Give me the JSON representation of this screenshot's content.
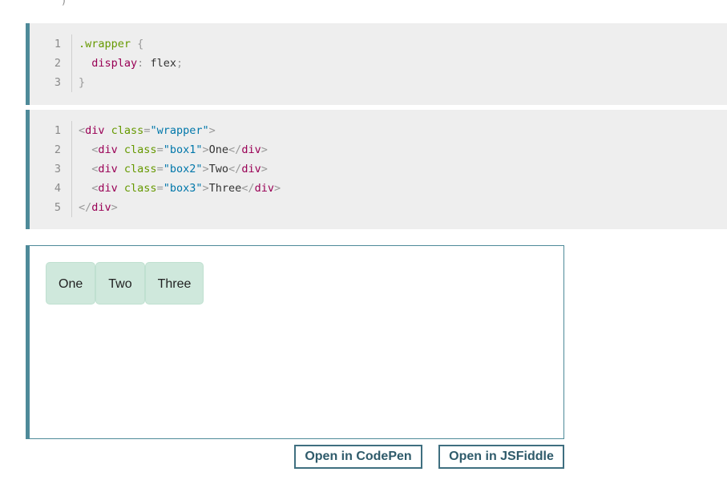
{
  "top_fragment": ")",
  "css_block": {
    "line_numbers": [
      "1",
      "2",
      "3"
    ],
    "line1": {
      "selector": ".wrapper",
      "brace": " {"
    },
    "line2": {
      "indent": "  ",
      "property": "display",
      "colon": ": ",
      "value": "flex",
      "semi": ";"
    },
    "line3": {
      "brace": "}"
    }
  },
  "html_block": {
    "line_numbers": [
      "1",
      "2",
      "3",
      "4",
      "5"
    ],
    "line1": {
      "open": "<",
      "tag": "div",
      "attr": " class",
      "eq": "=",
      "q1": "\"",
      "str": "wrapper",
      "q2": "\"",
      "close": ">"
    },
    "line2": {
      "indent": "  ",
      "open": "<",
      "tag": "div",
      "attr": " class",
      "eq": "=",
      "q1": "\"",
      "str": "box1",
      "q2": "\"",
      "close": ">",
      "text": "One",
      "end_open": "</",
      "end_tag": "div",
      "end_close": ">"
    },
    "line3": {
      "indent": "  ",
      "open": "<",
      "tag": "div",
      "attr": " class",
      "eq": "=",
      "q1": "\"",
      "str": "box2",
      "q2": "\"",
      "close": ">",
      "text": "Two",
      "end_open": "</",
      "end_tag": "div",
      "end_close": ">"
    },
    "line4": {
      "indent": "  ",
      "open": "<",
      "tag": "div",
      "attr": " class",
      "eq": "=",
      "q1": "\"",
      "str": "box3",
      "q2": "\"",
      "close": ">",
      "text": "Three",
      "end_open": "</",
      "end_tag": "div",
      "end_close": ">"
    },
    "line5": {
      "end_open": "</",
      "end_tag": "div",
      "end_close": ">"
    }
  },
  "result": {
    "boxes": [
      "One",
      "Two",
      "Three"
    ]
  },
  "buttons": {
    "codepen": "Open in CodePen",
    "jsfiddle": "Open in JSFiddle"
  },
  "colors": {
    "accent_border": "#4e8a99",
    "code_bg": "#eeeeee",
    "box_bg": "#cfe8dc",
    "button_text": "#2f5b6b"
  }
}
